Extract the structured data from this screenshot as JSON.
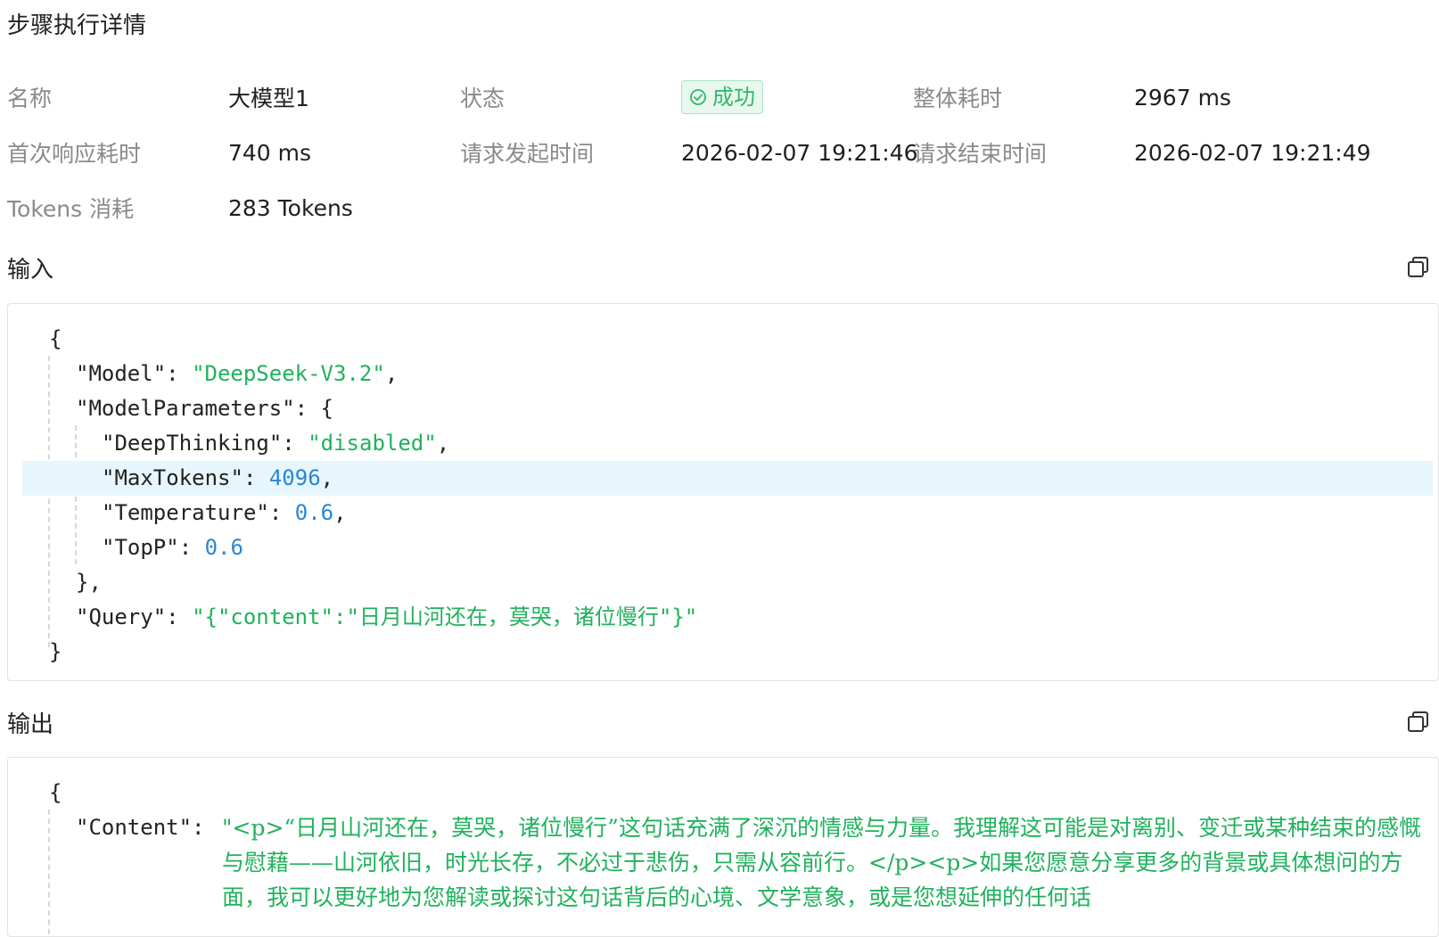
{
  "page": {
    "title": "步骤执行详情"
  },
  "info": {
    "name_label": "名称",
    "name_value": "大模型1",
    "status_label": "状态",
    "status_value": "成功",
    "total_time_label": "整体耗时",
    "total_time_value": "2967 ms",
    "first_resp_label": "首次响应耗时",
    "first_resp_value": "740 ms",
    "req_start_label": "请求发起时间",
    "req_start_value": "2026-02-07 19:21:46",
    "req_end_label": "请求结束时间",
    "req_end_value": "2026-02-07 19:21:49",
    "tokens_label": "Tokens 消耗",
    "tokens_value": "283 Tokens"
  },
  "input": {
    "title": "输入",
    "open_brace": "{",
    "model_key": "\"Model\"",
    "model_value": "\"DeepSeek-V3.2\"",
    "params_key": "\"ModelParameters\"",
    "params_open": "{",
    "deep_key": "\"DeepThinking\"",
    "deep_value": "\"disabled\"",
    "max_key": "\"MaxTokens\"",
    "max_value": "4096",
    "temp_key": "\"Temperature\"",
    "temp_value": "0.6",
    "topp_key": "\"TopP\"",
    "topp_value": "0.6",
    "params_close": "},",
    "query_key": "\"Query\"",
    "query_value": "\"{\"content\":\"日月山河还在，莫哭，诸位慢行\"}\"",
    "close_brace": "}"
  },
  "output": {
    "title": "输出",
    "open_brace": "{",
    "content_key": "\"Content\"",
    "content_value": "\"<p>“日月山河还在，莫哭，诸位慢行”这句话充满了深沉的情感与力量。我理解这可能是对离别、变迁或某种结束的感慨与慰藉——山河依旧，时光长存，不必过于悲伤，只需从容前行。</p><p>如果您愿意分享更多的背景或具体想问的方面，我可以更好地为您解读或探讨这句话背后的心境、文学意象，或是您想延伸的任何话"
  },
  "colors": {
    "string": "#20b25c",
    "number": "#2a86d3",
    "success": "#2fb868",
    "highlight": "#e7f6fd"
  },
  "icons": [
    "check-circle-icon",
    "copy-icon"
  ]
}
